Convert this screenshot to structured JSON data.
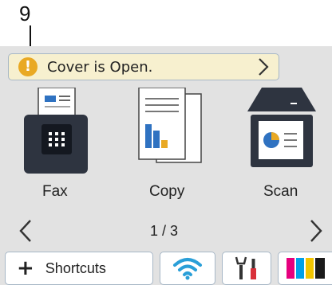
{
  "callout": {
    "number": "9"
  },
  "notification": {
    "icon": "warning-icon",
    "text": "Cover is Open.",
    "chevron": "chevron-right-icon"
  },
  "apps": [
    {
      "label": "Fax",
      "icon": "fax-icon"
    },
    {
      "label": "Copy",
      "icon": "copy-icon"
    },
    {
      "label": "Scan",
      "icon": "scan-icon"
    }
  ],
  "pager": {
    "indicator": "1 / 3",
    "prev_icon": "chevron-left-icon",
    "next_icon": "chevron-right-icon"
  },
  "bottom_bar": {
    "shortcuts_plus": "+",
    "shortcuts_label": "Shortcuts",
    "wifi_icon": "wifi-icon",
    "tools_icon": "settings-tools-icon",
    "ink_icon": "ink-toner-icon"
  },
  "colors": {
    "screen_bg": "#e2e2e2",
    "notice_bg": "#f7f0cf",
    "warning": "#e9a924",
    "border": "#a7b7c6",
    "wifi_blue": "#2a9fd8",
    "tool_red": "#d9303a"
  }
}
